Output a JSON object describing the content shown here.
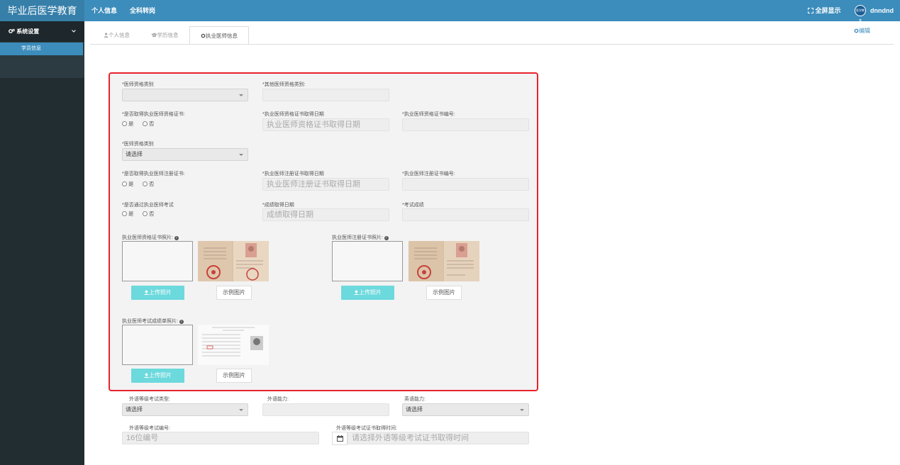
{
  "app": {
    "brand": "毕业后医学教育"
  },
  "topnav": {
    "item1": "个人信息",
    "item2": "全科转岗"
  },
  "topright": {
    "fullscreen": "全屏显示",
    "username": "dnndnd",
    "avatar_text": "医学教育"
  },
  "sidebar": {
    "header": "系统设置",
    "item": "学员信息"
  },
  "tabs": {
    "personal": "个人信息",
    "education": "学历信息",
    "physician": "执业医师信息"
  },
  "edit_label": "编辑",
  "form": {
    "qual_type_label": "*医师资格类别",
    "qual_type_value": "",
    "other_qual_label": "*其他医师资格类别:",
    "cert_obtained_label": "*是否取得执业医师资格证书:",
    "cert_date_label": "*执业医师资格证书取得日期",
    "cert_date_placeholder": "执业医师资格证书取得日期",
    "cert_no_label": "*执业医师资格证书编号:",
    "qual_type2_label": "*医师资格类别",
    "qual_type2_value": "请选择",
    "reg_obtained_label": "*是否取得执业医师注册证书:",
    "reg_date_label": "*执业医师注册证书取得日期",
    "reg_date_placeholder": "执业医师注册证书取得日期",
    "reg_no_label": "*执业医师注册证书编号:",
    "exam_passed_label": "*是否通过执业医师考试",
    "score_date_label": "*成绩取得日期",
    "score_date_placeholder": "成绩取得日期",
    "score_label": "*考试成绩",
    "yes": "是",
    "no": "否",
    "cert_photo_label": "执业医师资格证书照片:",
    "reg_photo_label": "执业医师注册证书照片:",
    "score_photo_label": "执业医师考试成绩单照片:",
    "upload_label": "上传照片",
    "example_label": "示例图片",
    "fl_type_label": "外语等级考试类型:",
    "fl_type_value": "请选择",
    "fl_ability_label": "外语能力:",
    "en_ability_label": "英语能力:",
    "en_ability_value": "请选择",
    "fl_no_label": "外语等级考试编号:",
    "fl_no_placeholder": "16位编号",
    "fl_date_label": "外语等级考试证书取得时间:",
    "fl_date_placeholder": "请选择外语等级考试证书取得时间"
  },
  "colors": {
    "topbar": "#3c8dbc",
    "sidebar": "#222d32",
    "highlight": "#e8232a",
    "upload_button": "#6cd9dd"
  },
  "icons": {
    "tab_personal": "user-icon",
    "tab_education": "graduation-cap-icon",
    "tab_physician": "gear-icon",
    "edit": "gear-icon",
    "fullscreen": "expand-icon",
    "info": "info-icon",
    "upload": "upload-icon",
    "calendar": "calendar-icon"
  }
}
